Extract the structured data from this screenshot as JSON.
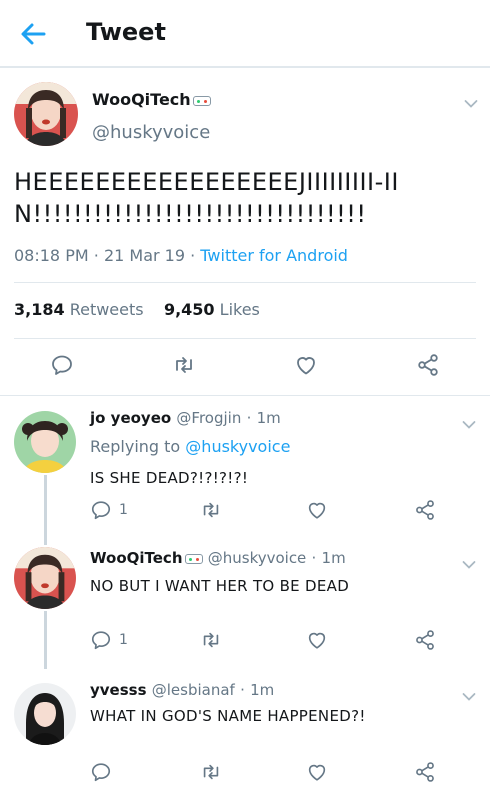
{
  "header": {
    "title": "Tweet"
  },
  "colors": {
    "accent": "#1da1f2",
    "muted": "#657786",
    "text": "#14171a",
    "divider": "#e1e8ed"
  },
  "main_tweet": {
    "display_name": "WooQiTech",
    "handle": "@huskyvoice",
    "text": "HEEEEEEEEEEEEEEEEEJIIIIIIIII-IIN!!!!!!!!!!!!!!!!!!!!!!!!!!!!!!!!!",
    "time": "08:18 PM",
    "date": "21 Mar 19",
    "sep": "·",
    "source": "Twitter for Android",
    "retweets_count": "3,184",
    "retweets_label": "Retweets",
    "likes_count": "9,450",
    "likes_label": "Likes"
  },
  "replies": [
    {
      "display_name": "jo yeoyeo",
      "handle": "@Frogjin",
      "age": "1m",
      "replying_prefix": "Replying to",
      "replying_to": "@huskyvoice",
      "text": "IS SHE DEAD?!?!?!?!",
      "reply_count": "1"
    },
    {
      "display_name": "WooQiTech",
      "handle": "@huskyvoice",
      "age": "1m",
      "text": "NO BUT I WANT HER TO BE DEAD",
      "reply_count": "1"
    },
    {
      "display_name": "yvesss",
      "handle": "@lesbianaf",
      "age": "1m",
      "text": "WHAT IN GOD'S NAME HAPPENED?!"
    }
  ],
  "icons": [
    "back-arrow-icon",
    "chevron-down-icon",
    "reply-icon",
    "retweet-icon",
    "like-icon",
    "share-icon"
  ]
}
